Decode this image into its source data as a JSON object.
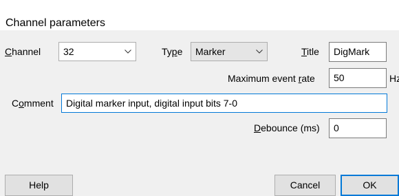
{
  "window": {
    "title": "Channel parameters"
  },
  "channel": {
    "label_first": "C",
    "label_rest": "hannel",
    "value": "32"
  },
  "type": {
    "label_a": "Ty",
    "label_u": "p",
    "label_b": "e",
    "value": "Marker"
  },
  "title_field": {
    "label_first": "T",
    "label_rest": "itle",
    "value": "DigMark"
  },
  "max_rate": {
    "label_a": "Maximum event ",
    "label_u": "r",
    "label_b": "ate",
    "value": "50",
    "unit": "Hz"
  },
  "comment": {
    "label_first": "C",
    "label_u": "o",
    "label_rest": "mment",
    "value": "Digital marker input, digital input bits 7-0"
  },
  "debounce": {
    "label_first": "D",
    "label_rest": "ebounce (ms)",
    "value": "0"
  },
  "buttons": {
    "help": "Help",
    "cancel": "Cancel",
    "ok": "OK"
  },
  "icons": {
    "dropdown": "chevron-down-icon"
  }
}
